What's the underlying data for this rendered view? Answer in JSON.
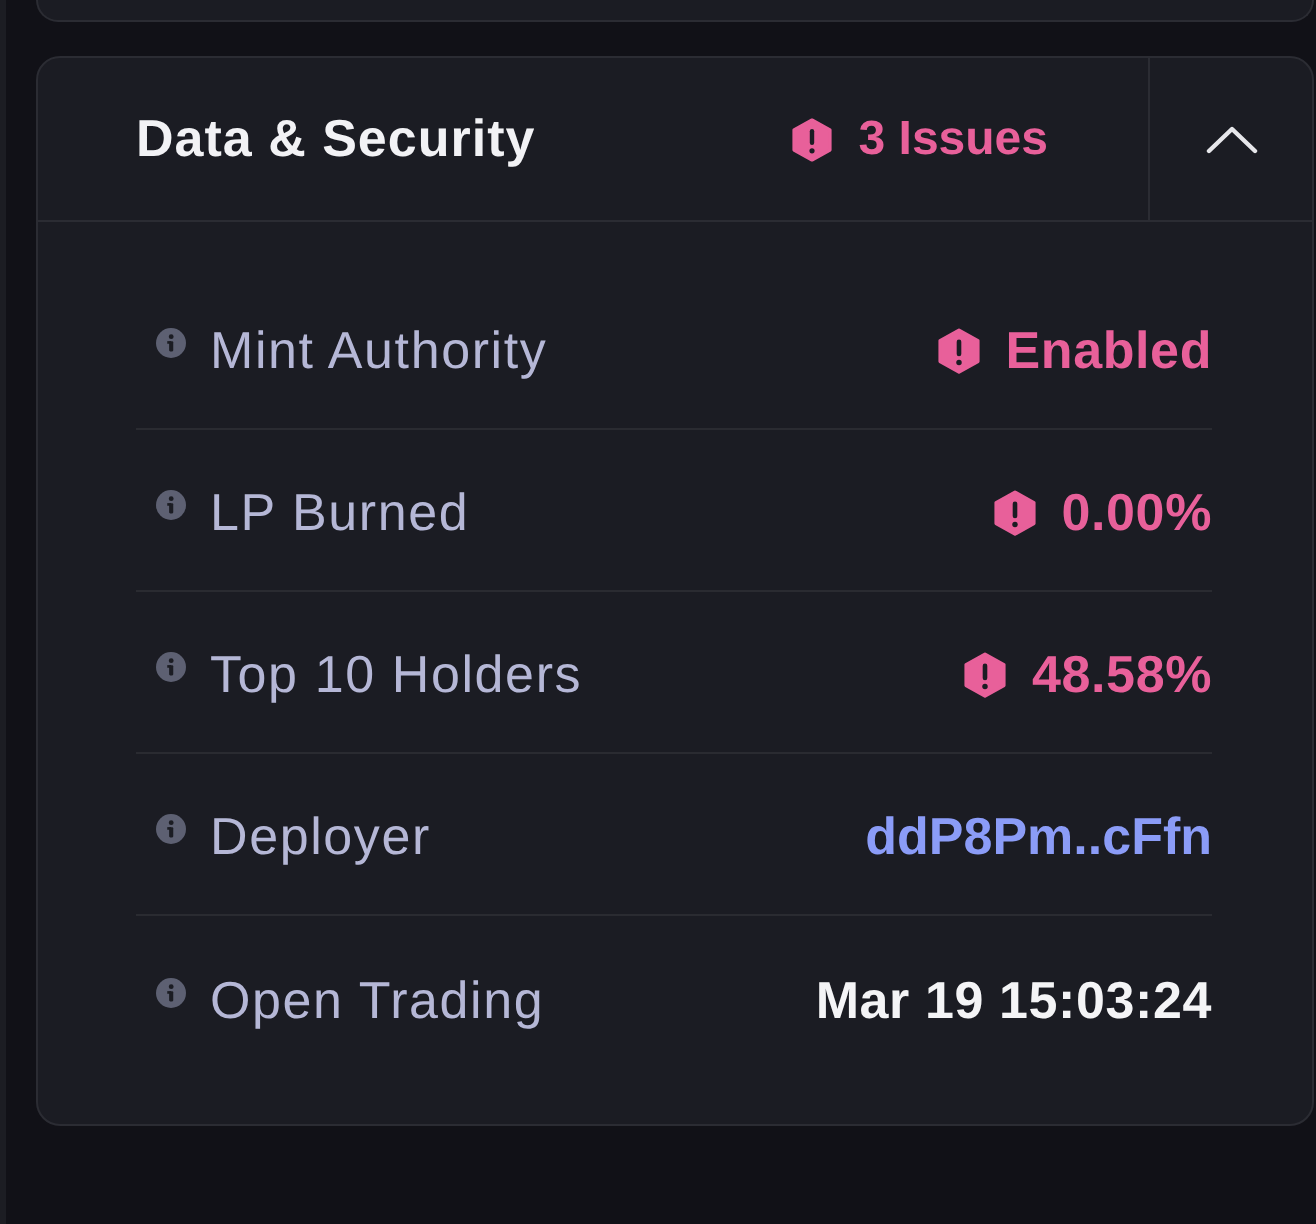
{
  "panel": {
    "title": "Data & Security",
    "issues": "3 Issues",
    "expanded": true
  },
  "rows": [
    {
      "kind": "warning",
      "label": "Mint Authority",
      "value": "Enabled"
    },
    {
      "kind": "warning",
      "label": "LP Burned",
      "value": "0.00%"
    },
    {
      "kind": "warning",
      "label": "Top 10 Holders",
      "value": "48.58%"
    },
    {
      "kind": "link",
      "label": "Deployer",
      "value": "ddP8Pm..cFfn"
    },
    {
      "kind": "plain",
      "label": "Open Trading",
      "value": "Mar 19 15:03:24"
    }
  ]
}
